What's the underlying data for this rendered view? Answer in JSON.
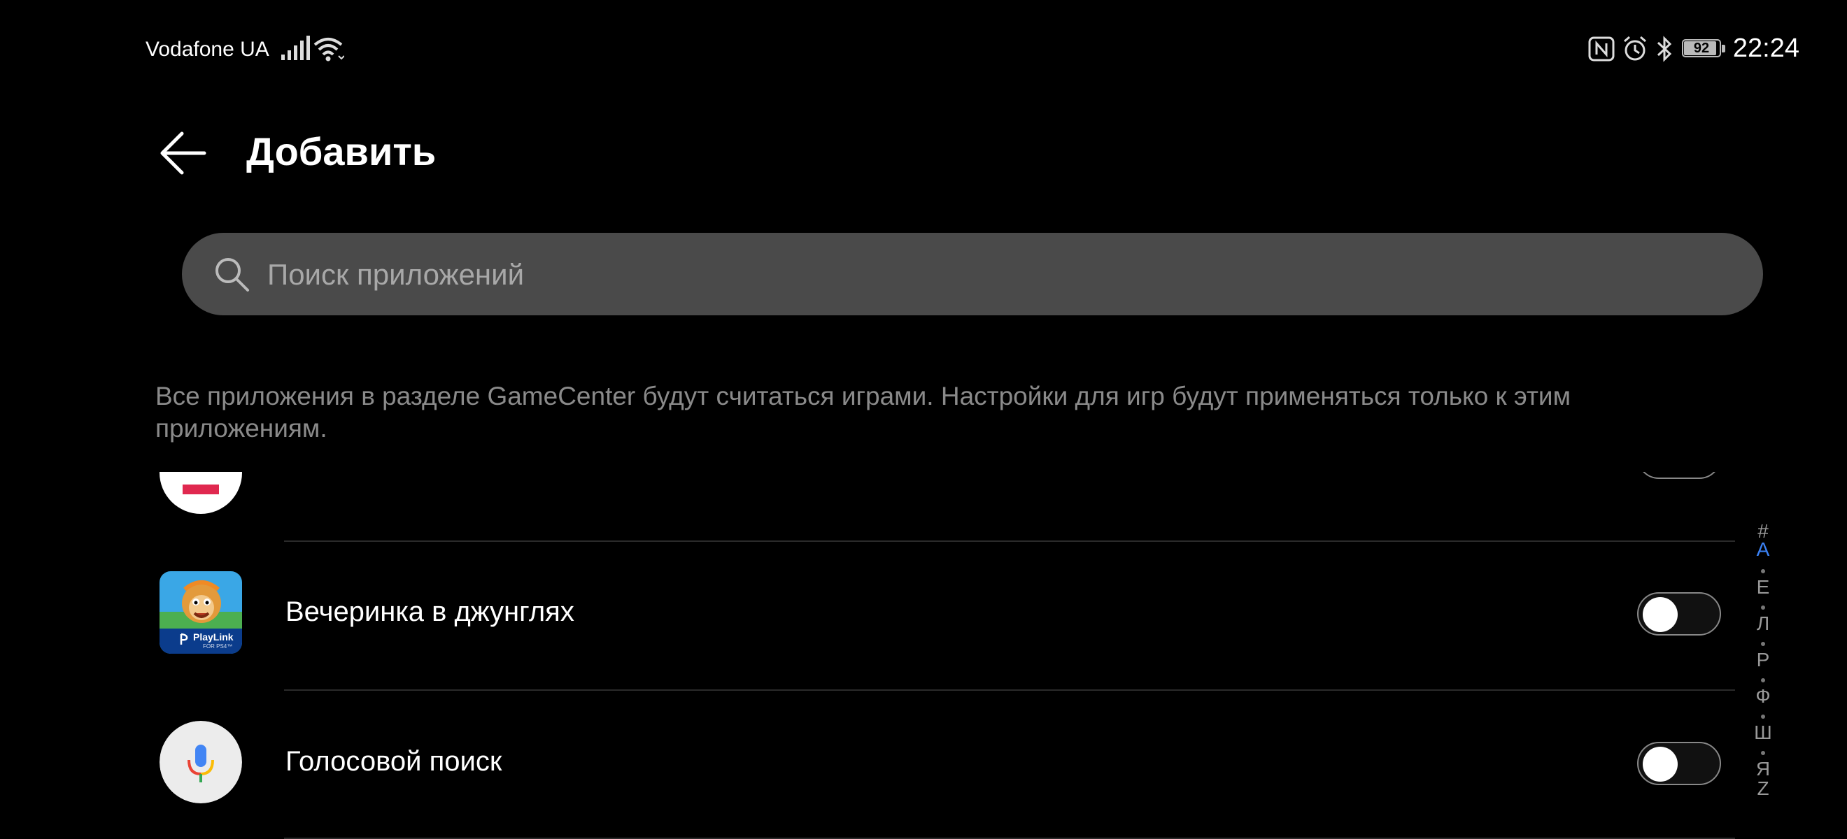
{
  "status_bar": {
    "carrier": "Vodafone UA",
    "battery": "92",
    "time": "22:24"
  },
  "header": {
    "title": "Добавить"
  },
  "search": {
    "placeholder": "Поиск приложений"
  },
  "description": "Все приложения в разделе GameCenter будут считаться играми. Настройки для игр будут применяться только к этим приложениям.",
  "apps": [
    {
      "label": "Вечеринка в джунглях",
      "enabled": false,
      "icon_badge": "PlayLink",
      "icon_badge_sub": "FOR PS4™"
    },
    {
      "label": "Голосовой поиск",
      "enabled": false
    }
  ],
  "alphabet_index": {
    "letters": [
      "#",
      "A",
      "Е",
      "Л",
      "Р",
      "Ф",
      "Ш",
      "Я",
      "Z"
    ],
    "active": "A"
  },
  "colors": {
    "background": "#000000",
    "search_bg": "#4a4a4a",
    "accent": "#3b82f6"
  }
}
